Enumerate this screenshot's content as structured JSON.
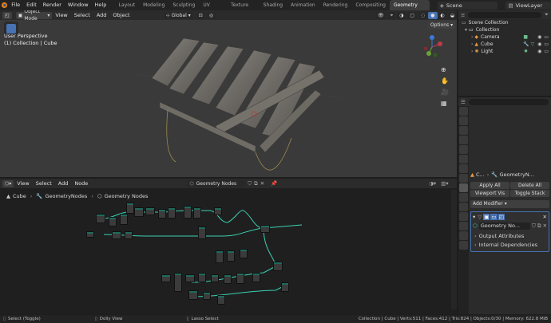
{
  "topbar": {
    "menus": [
      "File",
      "Edit",
      "Render",
      "Window",
      "Help"
    ],
    "workspaces": [
      "Layout",
      "Modeling",
      "Sculpting",
      "UV Editing",
      "Texture Paint",
      "Shading",
      "Animation",
      "Rendering",
      "Compositing",
      "Geometry Nodes"
    ],
    "active_workspace": "Geometry Nodes",
    "scene": "Scene",
    "view_layer": "ViewLayer"
  },
  "viewport": {
    "mode": "Object Mode",
    "menus": [
      "View",
      "Select",
      "Add",
      "Object"
    ],
    "transform": "Global",
    "perspective": "User Perspective",
    "collection_info": "(1) Collection | Cube",
    "options_label": "Options"
  },
  "outliner": {
    "root": "Scene Collection",
    "collection": "Collection",
    "items": [
      "Camera",
      "Cube",
      "Light"
    ]
  },
  "properties": {
    "breadcrumb_obj": "C...",
    "breadcrumb_mod": "GeometryN...",
    "apply_all": "Apply All",
    "delete_all": "Delete All",
    "viewport_vis": "Viewport Vis",
    "toggle_stack": "Toggle Stack",
    "add_modifier": "Add Modifier",
    "modifier_name": "Geometry No...",
    "output_attributes": "Output Attributes",
    "internal_dependencies": "Internal Dependencies"
  },
  "node_editor": {
    "menus": [
      "View",
      "Select",
      "Add",
      "Node"
    ],
    "node_tree": "Geometry Nodes",
    "breadcrumb": [
      "Cube",
      "GeometryNodes",
      "Geometry Nodes"
    ]
  },
  "status": {
    "left": "Select (Toggle)",
    "middle": "Dolly View",
    "lasso": "Lasso Select",
    "stats": "Collection | Cube | Verts:511 | Faces:412 | Tris:824 | Objects:0/30 | Memory: 622.8 MiB"
  },
  "colors": {
    "accent": "#4772b3",
    "node_link": "#3ad0b0",
    "active_tab": "#3d3d3d"
  }
}
